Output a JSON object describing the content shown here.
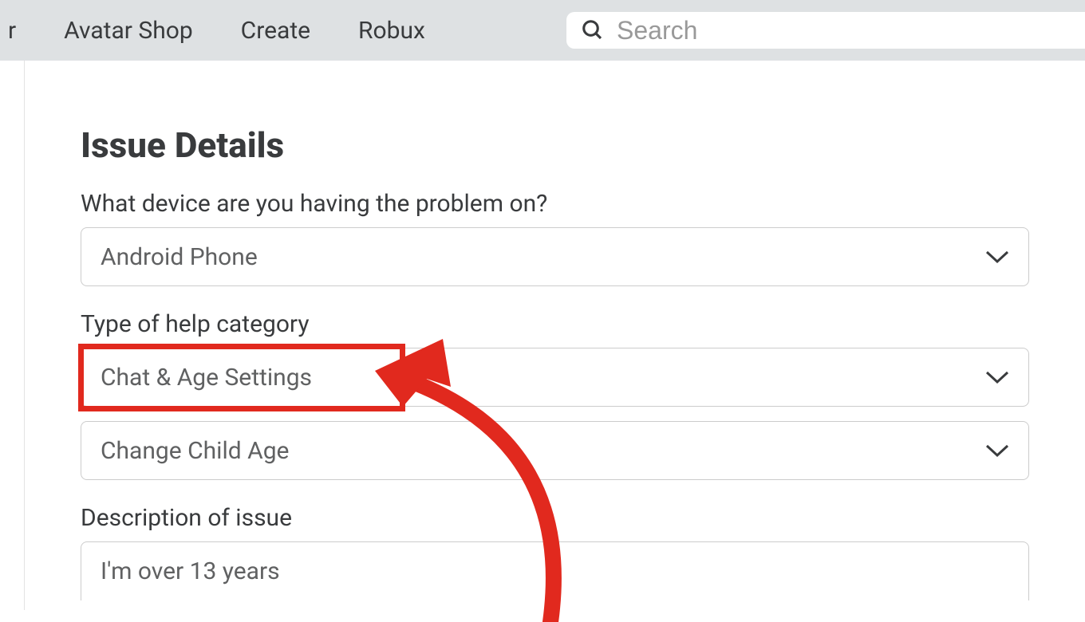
{
  "nav": {
    "partial_item": "r",
    "items": [
      "Avatar Shop",
      "Create",
      "Robux"
    ]
  },
  "search": {
    "placeholder": "Search"
  },
  "form": {
    "title": "Issue Details",
    "device_label": "What device are you having the problem on?",
    "device_value": "Android Phone",
    "category_label": "Type of help category",
    "category_value": "Chat & Age Settings",
    "subcategory_value": "Change Child Age",
    "description_label": "Description of issue",
    "description_value": "I'm over 13 years"
  }
}
